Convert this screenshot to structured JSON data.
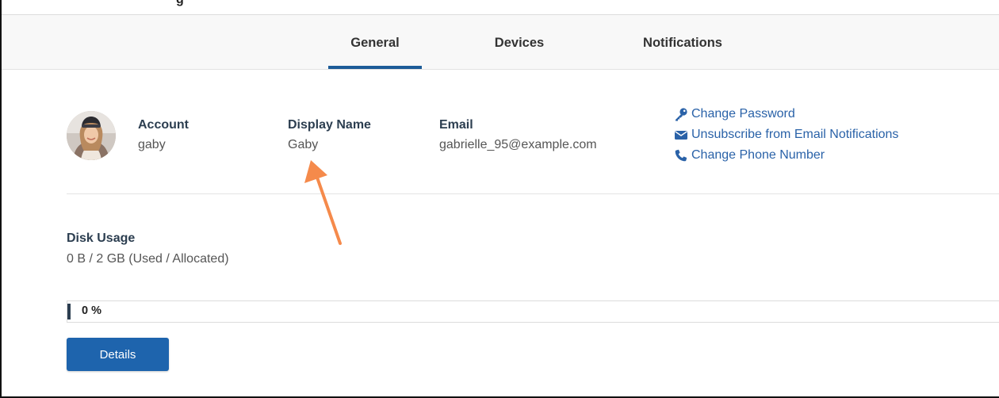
{
  "top_strip": {
    "clipped_text": "g"
  },
  "tabs": [
    {
      "label": "General",
      "active": true
    },
    {
      "label": "Devices",
      "active": false
    },
    {
      "label": "Notifications",
      "active": false
    }
  ],
  "profile": {
    "account": {
      "label": "Account",
      "value": "gaby"
    },
    "display_name": {
      "label": "Display Name",
      "value": "Gaby"
    },
    "email": {
      "label": "Email",
      "value": "gabrielle_95@example.com"
    }
  },
  "links": [
    {
      "label": "Change Password",
      "icon": "key-icon"
    },
    {
      "label": "Unsubscribe from Email Notifications",
      "icon": "envelope-icon"
    },
    {
      "label": "Change Phone Number",
      "icon": "phone-icon"
    }
  ],
  "disk_usage": {
    "label": "Disk Usage",
    "value": "0 B / 2 GB (Used / Allocated)",
    "percent_text": "0 %",
    "percent": 0
  },
  "details_button": {
    "label": "Details"
  },
  "colors": {
    "accent": "#1d5c98",
    "link": "#2a62a8",
    "button": "#1e64ad",
    "annotation_arrow": "#f58a4b"
  }
}
